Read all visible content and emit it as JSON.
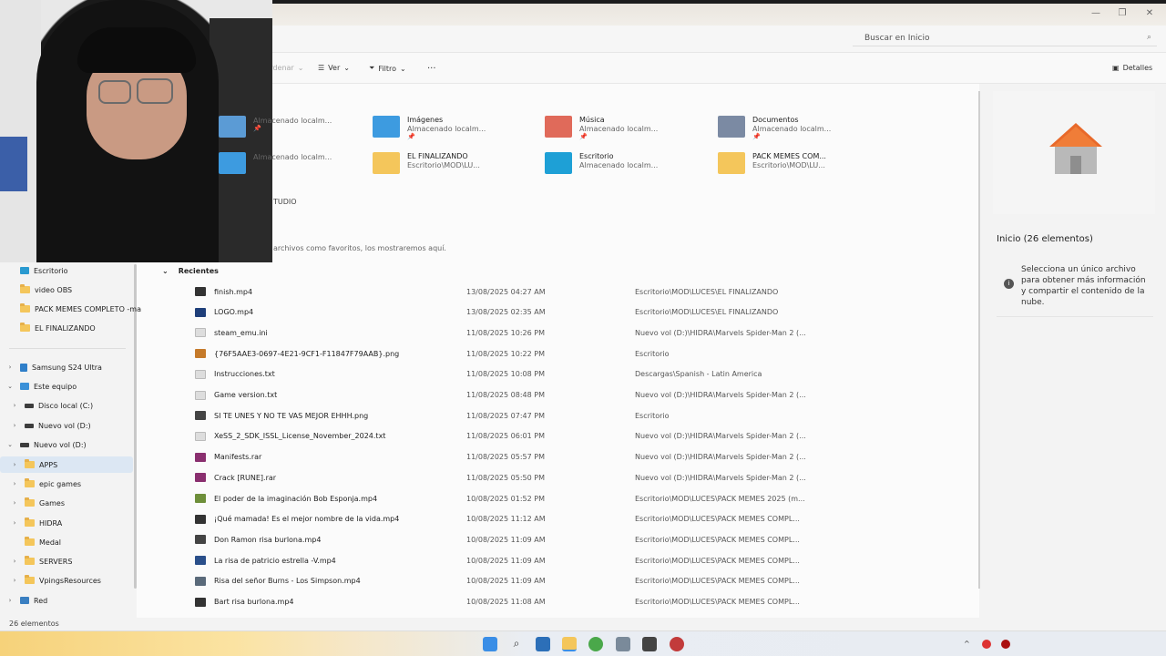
{
  "window": {
    "minimize": "—",
    "maximize": "❐",
    "close": "✕"
  },
  "search": {
    "placeholder": "Buscar en Inicio",
    "icon": "search-icon"
  },
  "toolbar": {
    "sort": "Ordenar",
    "view": "Ver",
    "filter": "Filtro",
    "more": "···",
    "details": "Detalles"
  },
  "quick_access": [
    {
      "name": "",
      "sub": "Almacenado localm...",
      "pinned": true,
      "color": "#5b9bd5"
    },
    {
      "name": "Imágenes",
      "sub": "Almacenado localm...",
      "pinned": true,
      "color": "#3d9be0"
    },
    {
      "name": "Música",
      "sub": "Almacenado localm...",
      "pinned": true,
      "color": "#e06a5a"
    },
    {
      "name": "Documentos",
      "sub": "Almacenado localm...",
      "pinned": true,
      "color": "#7b8aa3"
    },
    {
      "name": "",
      "sub": "Almacenado localm...",
      "pinned": false,
      "color": "#3d9be0"
    },
    {
      "name": "EL FINALIZANDO",
      "sub": "Escritorio\\MOD\\LU...",
      "pinned": false,
      "color": "#f4c65b"
    },
    {
      "name": "Escritorio",
      "sub": "Almacenado localm...",
      "pinned": false,
      "color": "#1ea0d6"
    },
    {
      "name": "PACK MEMES COM...",
      "sub": "Escritorio\\MOD\\LU...",
      "pinned": false,
      "color": "#f4c65b"
    }
  ],
  "partial_label": "TUDIO",
  "favorites_hint": "archivos como favoritos, los mostraremos aquí.",
  "recent_heading": "Recientes",
  "files": [
    {
      "name": "finish.mp4",
      "date": "13/08/2025 04:27 AM",
      "loc": "Escritorio\\MOD\\LUCES\\EL FINALIZANDO",
      "color": "#333"
    },
    {
      "name": "LOGO.mp4",
      "date": "13/08/2025 02:35 AM",
      "loc": "Escritorio\\MOD\\LUCES\\EL FINALIZANDO",
      "color": "#1f3f7a"
    },
    {
      "name": "steam_emu.ini",
      "date": "11/08/2025 10:26 PM",
      "loc": "Nuevo vol (D:)\\HIDRA\\Marvels Spider-Man 2 (...",
      "color": "#ddd"
    },
    {
      "name": "{76F5AAE3-0697-4E21-9CF1-F11847F79AAB}.png",
      "date": "11/08/2025 10:22 PM",
      "loc": "Escritorio",
      "color": "#c57a2a"
    },
    {
      "name": "Instrucciones.txt",
      "date": "11/08/2025 10:08 PM",
      "loc": "Descargas\\Spanish - Latin America",
      "color": "#ddd"
    },
    {
      "name": "Game version.txt",
      "date": "11/08/2025 08:48 PM",
      "loc": "Nuevo vol (D:)\\HIDRA\\Marvels Spider-Man 2 (...",
      "color": "#ddd"
    },
    {
      "name": "SI TE UNES Y NO TE VAS MEJOR EHHH.png",
      "date": "11/08/2025 07:47 PM",
      "loc": "Escritorio",
      "color": "#444"
    },
    {
      "name": "XeSS_2_SDK_ISSL_License_November_2024.txt",
      "date": "11/08/2025 06:01 PM",
      "loc": "Nuevo vol (D:)\\HIDRA\\Marvels Spider-Man 2 (...",
      "color": "#ddd"
    },
    {
      "name": "Manifests.rar",
      "date": "11/08/2025 05:57 PM",
      "loc": "Nuevo vol (D:)\\HIDRA\\Marvels Spider-Man 2 (...",
      "color": "#8a2f6f"
    },
    {
      "name": "Crack [RUNE].rar",
      "date": "11/08/2025 05:50 PM",
      "loc": "Nuevo vol (D:)\\HIDRA\\Marvels Spider-Man 2 (...",
      "color": "#8a2f6f"
    },
    {
      "name": "El poder de la imaginación Bob Esponja.mp4",
      "date": "10/08/2025 01:52 PM",
      "loc": "Escritorio\\MOD\\LUCES\\PACK MEMES 2025 (m...",
      "color": "#6e8f3a"
    },
    {
      "name": "¡Qué mamada! Es el mejor nombre de la vida.mp4",
      "date": "10/08/2025 11:12 AM",
      "loc": "Escritorio\\MOD\\LUCES\\PACK MEMES COMPL...",
      "color": "#333"
    },
    {
      "name": "Don Ramon risa burlona.mp4",
      "date": "10/08/2025 11:09 AM",
      "loc": "Escritorio\\MOD\\LUCES\\PACK MEMES COMPL...",
      "color": "#444"
    },
    {
      "name": "La risa de patricio estrella -V.mp4",
      "date": "10/08/2025 11:09 AM",
      "loc": "Escritorio\\MOD\\LUCES\\PACK MEMES COMPL...",
      "color": "#2a4f8a"
    },
    {
      "name": "Risa del señor Burns - Los Simpson.mp4",
      "date": "10/08/2025 11:09 AM",
      "loc": "Escritorio\\MOD\\LUCES\\PACK MEMES COMPL...",
      "color": "#5a6a7a"
    },
    {
      "name": "Bart risa burlona.mp4",
      "date": "10/08/2025 11:08 AM",
      "loc": "Escritorio\\MOD\\LUCES\\PACK MEMES COMPL...",
      "color": "#333"
    }
  ],
  "sidebar": {
    "pinned": [
      {
        "label": "Escritorio",
        "icon": "desktop-icon"
      },
      {
        "label": "video OBS",
        "icon": "folder-icon"
      },
      {
        "label": "PACK MEMES COMPLETO -ma",
        "icon": "folder-icon"
      },
      {
        "label": "EL FINALIZANDO",
        "icon": "folder-icon"
      }
    ],
    "tree": [
      {
        "label": "Samsung S24 Ultra",
        "icon": "phone",
        "chev": "›",
        "indent": 0
      },
      {
        "label": "Este equipo",
        "icon": "pc",
        "chev": "⌄",
        "indent": 0
      },
      {
        "label": "Disco local (C:)",
        "icon": "drive",
        "chev": "›",
        "indent": 1
      },
      {
        "label": "Nuevo vol (D:)",
        "icon": "drive",
        "chev": "›",
        "indent": 1
      },
      {
        "label": "Nuevo vol (D:)",
        "icon": "drive",
        "chev": "⌄",
        "indent": 0
      },
      {
        "label": "APPS",
        "icon": "folder",
        "chev": "›",
        "indent": 1,
        "selected": true
      },
      {
        "label": "epic games",
        "icon": "folder",
        "chev": "›",
        "indent": 1
      },
      {
        "label": "Games",
        "icon": "folder",
        "chev": "›",
        "indent": 1
      },
      {
        "label": "HIDRA",
        "icon": "folder",
        "chev": "›",
        "indent": 1
      },
      {
        "label": "Medal",
        "icon": "folder",
        "chev": "",
        "indent": 1
      },
      {
        "label": "SERVERS",
        "icon": "folder",
        "chev": "›",
        "indent": 1
      },
      {
        "label": "VpingsResources",
        "icon": "folder",
        "chev": "›",
        "indent": 1
      },
      {
        "label": "Red",
        "icon": "net",
        "chev": "›",
        "indent": 0
      }
    ]
  },
  "details_pane": {
    "title": "Inicio (26 elementos)",
    "info": "Selecciona un único archivo para obtener más información y compartir el contenido de la nube."
  },
  "status_bar": "26 elementos"
}
